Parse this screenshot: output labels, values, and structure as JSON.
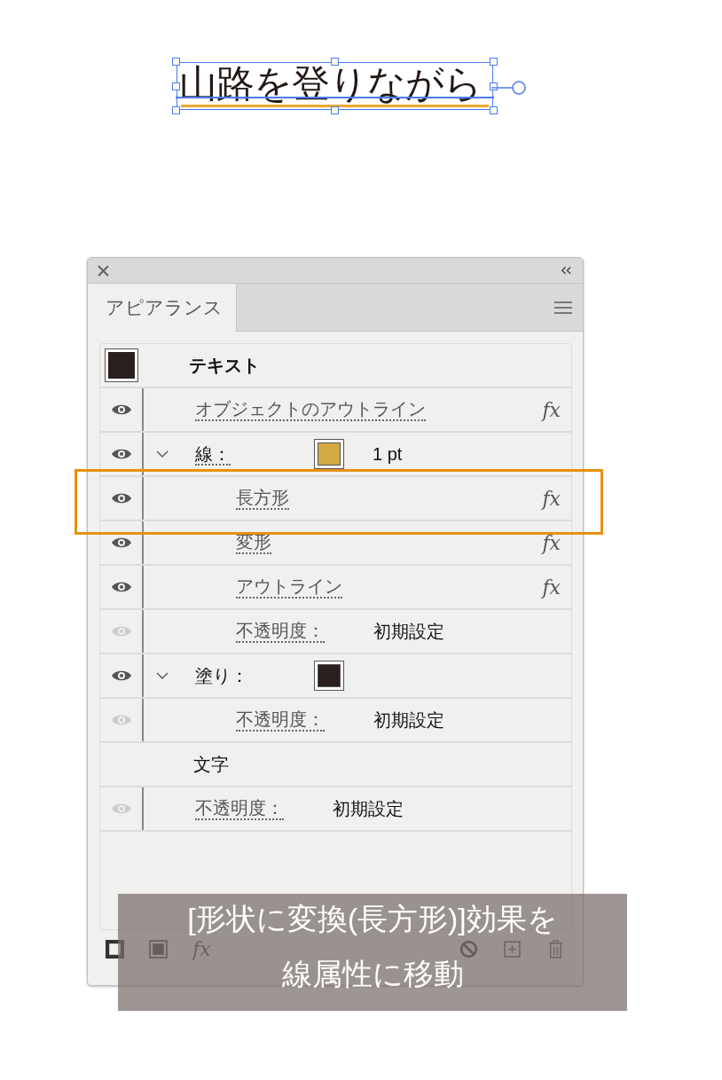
{
  "artboard": {
    "text": "山路を登りながら"
  },
  "panel": {
    "tabs": [
      {
        "label": "アピアランス",
        "selected": true
      }
    ],
    "items": [
      {
        "kind": "object",
        "label": "テキスト",
        "color": "#2a1f1f"
      },
      {
        "kind": "effect",
        "label": "オブジェクトのアウトライン",
        "visible": true,
        "fx": "fx"
      },
      {
        "kind": "stroke",
        "label": "線：",
        "visible": true,
        "expanded": true,
        "color": "#d4a843",
        "value": "1 pt",
        "children": [
          {
            "kind": "effect",
            "label": "長方形",
            "visible": true,
            "fx": "fx",
            "highlighted": true
          },
          {
            "kind": "effect",
            "label": "変形",
            "visible": true,
            "fx": "fx"
          },
          {
            "kind": "effect",
            "label": "アウトライン",
            "visible": true,
            "fx": "fx"
          },
          {
            "kind": "opacity",
            "label": "不透明度：",
            "visible": false,
            "value": "初期設定"
          }
        ]
      },
      {
        "kind": "fill",
        "label": "塗り：",
        "visible": true,
        "expanded": true,
        "color": "#2a1f1f",
        "children": [
          {
            "kind": "opacity",
            "label": "不透明度：",
            "visible": false,
            "value": "初期設定"
          }
        ]
      },
      {
        "kind": "group",
        "label": "文字"
      },
      {
        "kind": "opacity",
        "label": "不透明度：",
        "visible": false,
        "value": "初期設定"
      }
    ],
    "footer": {
      "fx_label": "fx"
    }
  },
  "caption": {
    "lines": [
      "[形状に変換(長方形)]効果を",
      "線属性に移動"
    ]
  }
}
